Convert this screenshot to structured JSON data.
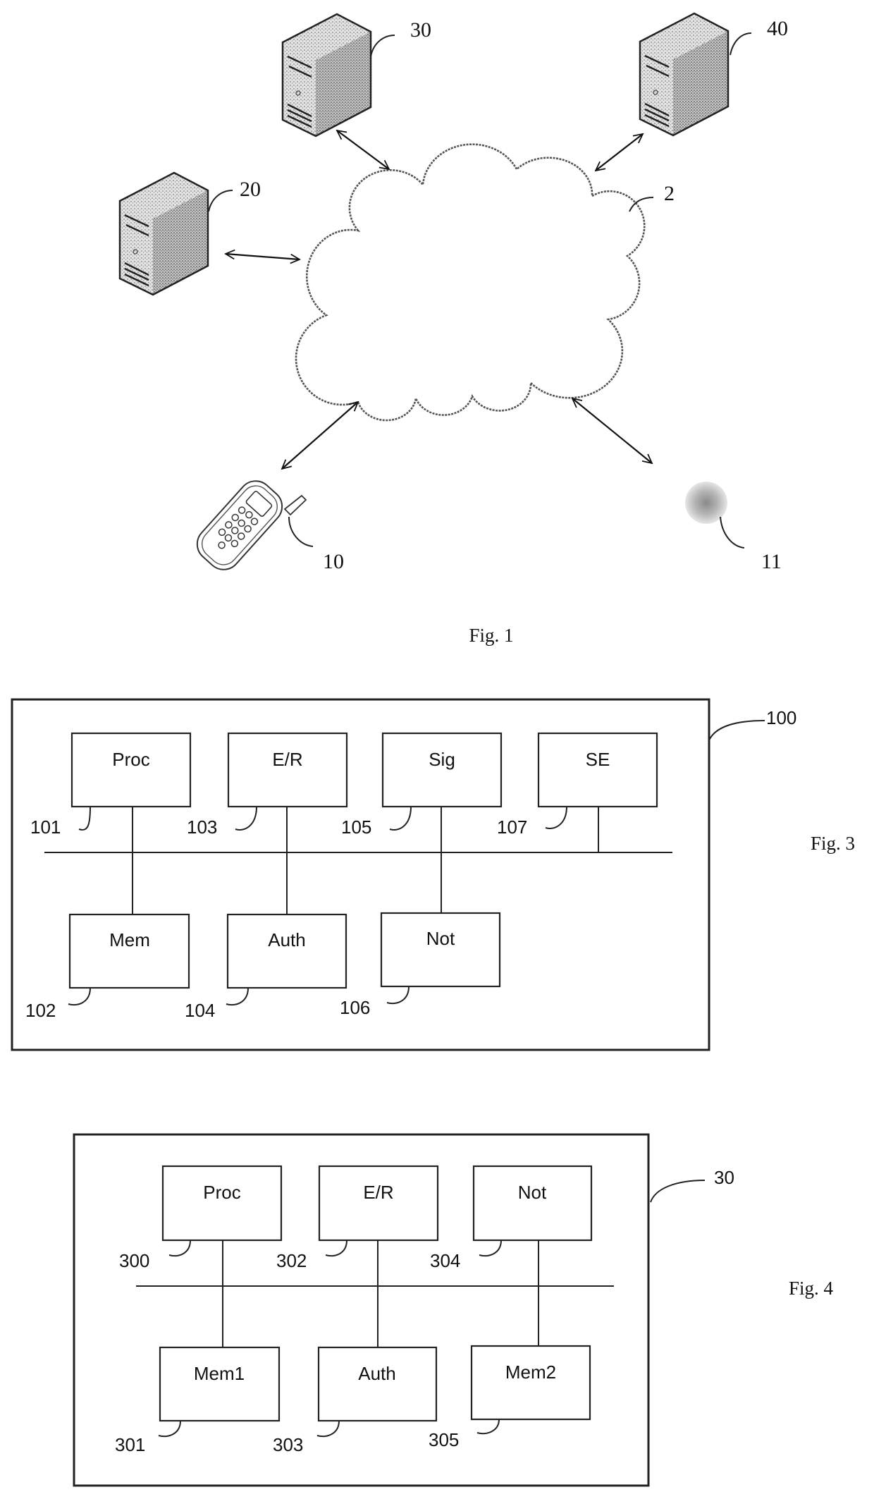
{
  "figure1": {
    "caption": "Fig. 1",
    "network": {
      "ref": "2",
      "icon": "cloud-icon"
    },
    "servers": [
      {
        "ref": "20",
        "icon": "server-tower-icon"
      },
      {
        "ref": "30",
        "icon": "server-tower-icon"
      },
      {
        "ref": "40",
        "icon": "server-tower-icon"
      }
    ],
    "mobile_device": {
      "ref": "10",
      "icon": "mobile-phone-icon"
    },
    "token_device": {
      "ref": "11",
      "icon": "round-token-icon"
    },
    "links": [
      "bidirectional",
      "bidirectional",
      "bidirectional",
      "bidirectional",
      "bidirectional"
    ]
  },
  "figure3": {
    "caption": "Fig. 3",
    "container_ref": "100",
    "modules_top": [
      {
        "label": "Proc",
        "ref": "101"
      },
      {
        "label": "E/R",
        "ref": "103"
      },
      {
        "label": "Sig",
        "ref": "105"
      },
      {
        "label": "SE",
        "ref": "107"
      }
    ],
    "modules_bottom": [
      {
        "label": "Mem",
        "ref": "102"
      },
      {
        "label": "Auth",
        "ref": "104"
      },
      {
        "label": "Not",
        "ref": "106"
      }
    ]
  },
  "figure4": {
    "caption": "Fig. 4",
    "container_ref": "30",
    "modules_top": [
      {
        "label": "Proc",
        "ref": "300"
      },
      {
        "label": "E/R",
        "ref": "302"
      },
      {
        "label": "Not",
        "ref": "304"
      }
    ],
    "modules_bottom": [
      {
        "label": "Mem1",
        "ref": "301"
      },
      {
        "label": "Auth",
        "ref": "303"
      },
      {
        "label": "Mem2",
        "ref": "305"
      }
    ]
  },
  "colors": {
    "ink": "#111111",
    "paper": "#ffffff",
    "stipple": "#bdbdbd"
  }
}
